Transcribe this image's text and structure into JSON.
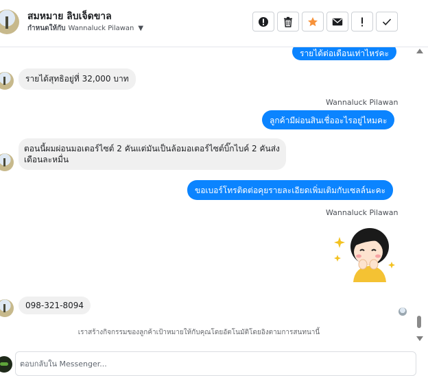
{
  "header": {
    "contact_name": "สมหมาย ลิบเจ็ดขาล",
    "assigned_label": "กำหนดให้กับ",
    "assigned_to": "Wannaluck Pilawan",
    "toolbar": [
      {
        "name": "spam-button",
        "icon": "alert-circle-icon"
      },
      {
        "name": "delete-button",
        "icon": "trash-icon"
      },
      {
        "name": "star-button",
        "icon": "star-icon"
      },
      {
        "name": "mark-unread-button",
        "icon": "envelope-icon"
      },
      {
        "name": "follow-up-button",
        "icon": "exclamation-icon"
      },
      {
        "name": "mark-done-button",
        "icon": "check-icon"
      }
    ]
  },
  "messages": {
    "m1": "รายได้ต่อเดือนเท่าไหร่คะ",
    "m2": "รายได้สุทธิอยู่ที่ 32,000 บาท",
    "sender1": "Wannaluck Pilawan",
    "m3": "ลูกค้ามีผ่อนสินเชื่ออะไรอยู่ไหมคะ",
    "m4": "ตอนนี้ผมผ่อนมอเตอร์ไซต์ 2 คันแต่มันเป็นล้อมอเตอร์ไซต์บิ๊กไบค์ 2 คันส่งเดือนละหมื่น",
    "m5": "ขอเบอร์โทรติดต่อคุยรายละเอียดเพิ่มเติมกับเซลล์นะคะ",
    "sender2": "Wannaluck Pilawan",
    "sticker": "girl-happy-sticker",
    "m6": "098-321-8094"
  },
  "notice": "เราสร้างกิจกรรมของลูกค้าเป้าหมายให้กับคุณโดยอัตโนมัติโดยอิงตามการสนทนานี้",
  "composer": {
    "placeholder": "ตอบกลับใน Messenger..."
  },
  "colors": {
    "accent": "#0b84ff",
    "incoming_bubble": "#f0f0f0",
    "star": "#f7923a"
  }
}
